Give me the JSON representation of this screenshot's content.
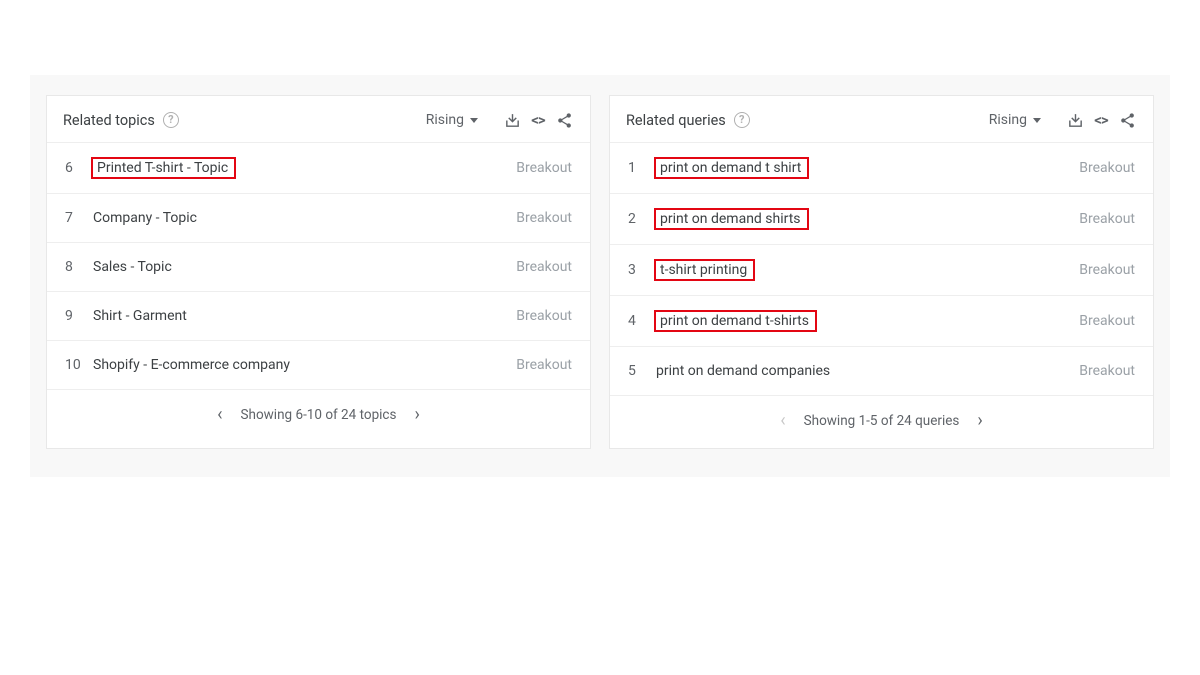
{
  "panels": {
    "topics": {
      "title": "Related topics",
      "sort": "Rising",
      "pager_text": "Showing 6-10 of 24 topics",
      "prev_enabled": true,
      "items": [
        {
          "rank": "6",
          "label": "Printed T-shirt - Topic",
          "value": "Breakout",
          "highlight": true
        },
        {
          "rank": "7",
          "label": "Company - Topic",
          "value": "Breakout",
          "highlight": false
        },
        {
          "rank": "8",
          "label": "Sales - Topic",
          "value": "Breakout",
          "highlight": false
        },
        {
          "rank": "9",
          "label": "Shirt - Garment",
          "value": "Breakout",
          "highlight": false
        },
        {
          "rank": "10",
          "label": "Shopify - E-commerce company",
          "value": "Breakout",
          "highlight": false
        }
      ]
    },
    "queries": {
      "title": "Related queries",
      "sort": "Rising",
      "pager_text": "Showing 1-5 of 24 queries",
      "prev_enabled": false,
      "items": [
        {
          "rank": "1",
          "label": "print on demand t shirt",
          "value": "Breakout",
          "highlight": true
        },
        {
          "rank": "2",
          "label": "print on demand shirts",
          "value": "Breakout",
          "highlight": true
        },
        {
          "rank": "3",
          "label": "t-shirt printing",
          "value": "Breakout",
          "highlight": true
        },
        {
          "rank": "4",
          "label": "print on demand t-shirts",
          "value": "Breakout",
          "highlight": true
        },
        {
          "rank": "5",
          "label": "print on demand companies",
          "value": "Breakout",
          "highlight": false
        }
      ]
    }
  }
}
